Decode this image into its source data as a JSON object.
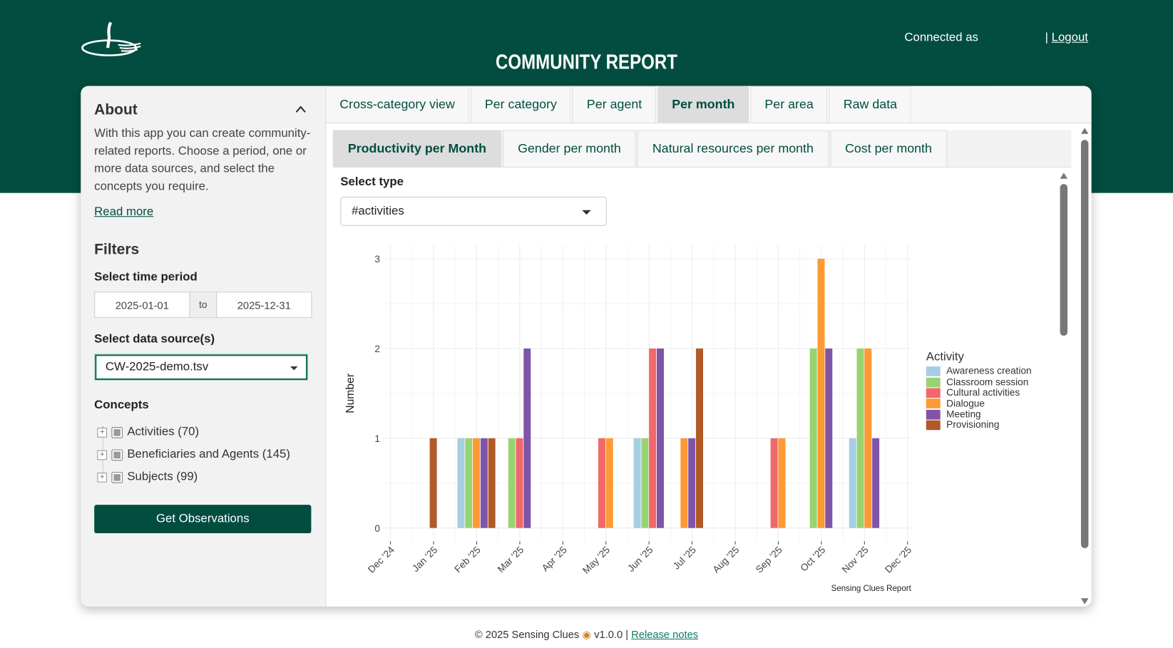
{
  "header": {
    "title": "COMMUNITY REPORT",
    "connected_as": "Connected as",
    "logout_sep": "|",
    "logout": "Logout"
  },
  "sidebar": {
    "about_title": "About",
    "about_text": "With this app you can create community-related reports. Choose a period, one or more data sources, and select the concepts you require.",
    "read_more": "Read more",
    "filters_title": "Filters",
    "time_label": "Select time period",
    "date_from": "2025-01-01",
    "date_to_sep": "to",
    "date_to": "2025-12-31",
    "source_label": "Select data source(s)",
    "source_value": "CW-2025-demo.tsv",
    "concepts_label": "Concepts",
    "concepts": [
      {
        "label": "Activities (70)"
      },
      {
        "label": "Beneficiaries and Agents (145)"
      },
      {
        "label": "Subjects (99)"
      }
    ],
    "get_button": "Get Observations"
  },
  "tabs": [
    {
      "label": "Cross-category view"
    },
    {
      "label": "Per category"
    },
    {
      "label": "Per agent"
    },
    {
      "label": "Per month",
      "active": true
    },
    {
      "label": "Per area"
    },
    {
      "label": "Raw data"
    }
  ],
  "subtabs": [
    {
      "label": "Productivity per Month",
      "active": true
    },
    {
      "label": "Gender per month"
    },
    {
      "label": "Natural resources per month"
    },
    {
      "label": "Cost per month"
    }
  ],
  "select_type": {
    "label": "Select type",
    "value": "#activities"
  },
  "footer": {
    "text": "© 2025 Sensing Clues",
    "version": "v1.0.0 |",
    "link": "Release notes"
  },
  "chart_data": {
    "type": "bar",
    "ylabel": "Number",
    "caption": "Sensing Clues Report",
    "legend_title": "Activity",
    "legend_position": "right",
    "grid": true,
    "ylim": [
      0,
      3
    ],
    "yticks": [
      "0",
      "1",
      "2",
      "3"
    ],
    "x_ticks": [
      "Dec '24",
      "Jan '25",
      "Feb '25",
      "Mar '25",
      "Apr '25",
      "May '25",
      "Jun '25",
      "Jul '25",
      "Aug '25",
      "Sep '25",
      "Oct '25",
      "Nov '25",
      "Dec '25"
    ],
    "categories": [
      "Jan '25",
      "Feb '25",
      "Mar '25",
      "Apr '25",
      "May '25",
      "Jun '25",
      "Jul '25",
      "Aug '25",
      "Sep '25",
      "Oct '25",
      "Nov '25"
    ],
    "series": [
      {
        "name": "Awareness creation",
        "color": "#a6cee3",
        "values": [
          0,
          1,
          0,
          0,
          0,
          1,
          0,
          0,
          0,
          0,
          1
        ]
      },
      {
        "name": "Classroom session",
        "color": "#99d371",
        "values": [
          0,
          1,
          1,
          0,
          0,
          1,
          0,
          0,
          0,
          2,
          2
        ]
      },
      {
        "name": "Cultural activities",
        "color": "#f0686a",
        "values": [
          0,
          0,
          1,
          0,
          1,
          2,
          0,
          0,
          1,
          0,
          0
        ]
      },
      {
        "name": "Dialogue",
        "color": "#ff9933",
        "values": [
          0,
          1,
          0,
          0,
          1,
          0,
          1,
          0,
          1,
          3,
          2
        ]
      },
      {
        "name": "Meeting",
        "color": "#7f54a6",
        "values": [
          0,
          1,
          2,
          0,
          0,
          2,
          1,
          0,
          0,
          2,
          1
        ]
      },
      {
        "name": "Provisioning",
        "color": "#b15928",
        "values": [
          1,
          1,
          0,
          0,
          0,
          0,
          2,
          0,
          0,
          0,
          0
        ]
      }
    ]
  }
}
